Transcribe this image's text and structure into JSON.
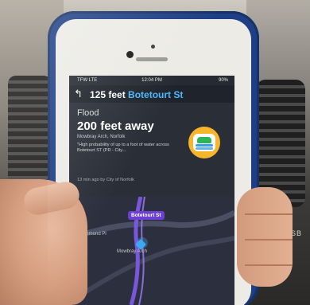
{
  "scene": {
    "status_bar": {
      "left": "TFW LTE",
      "time": "12:04 PM",
      "battery": "90%"
    },
    "nav": {
      "distance": "125 feet",
      "street": "Botetourt St"
    },
    "alert": {
      "type": "Flood",
      "distance": "200 feet away",
      "location": "Mowbray Arch, Norfolk",
      "description": "\"High probability of up to a foot of water across Botetourt ST (PR - City...",
      "meta": "13 min ago by City of Norfolk"
    },
    "map": {
      "street_label": "Botetourt St",
      "label_1": "Drummond Pl",
      "label_2": "Mowbray Arch"
    },
    "background_text": "USB",
    "colors": {
      "accent": "#49b8ff",
      "badge": "#f6b52a",
      "purple": "#6a3fd2",
      "phone_case": "#1e3f86"
    }
  }
}
